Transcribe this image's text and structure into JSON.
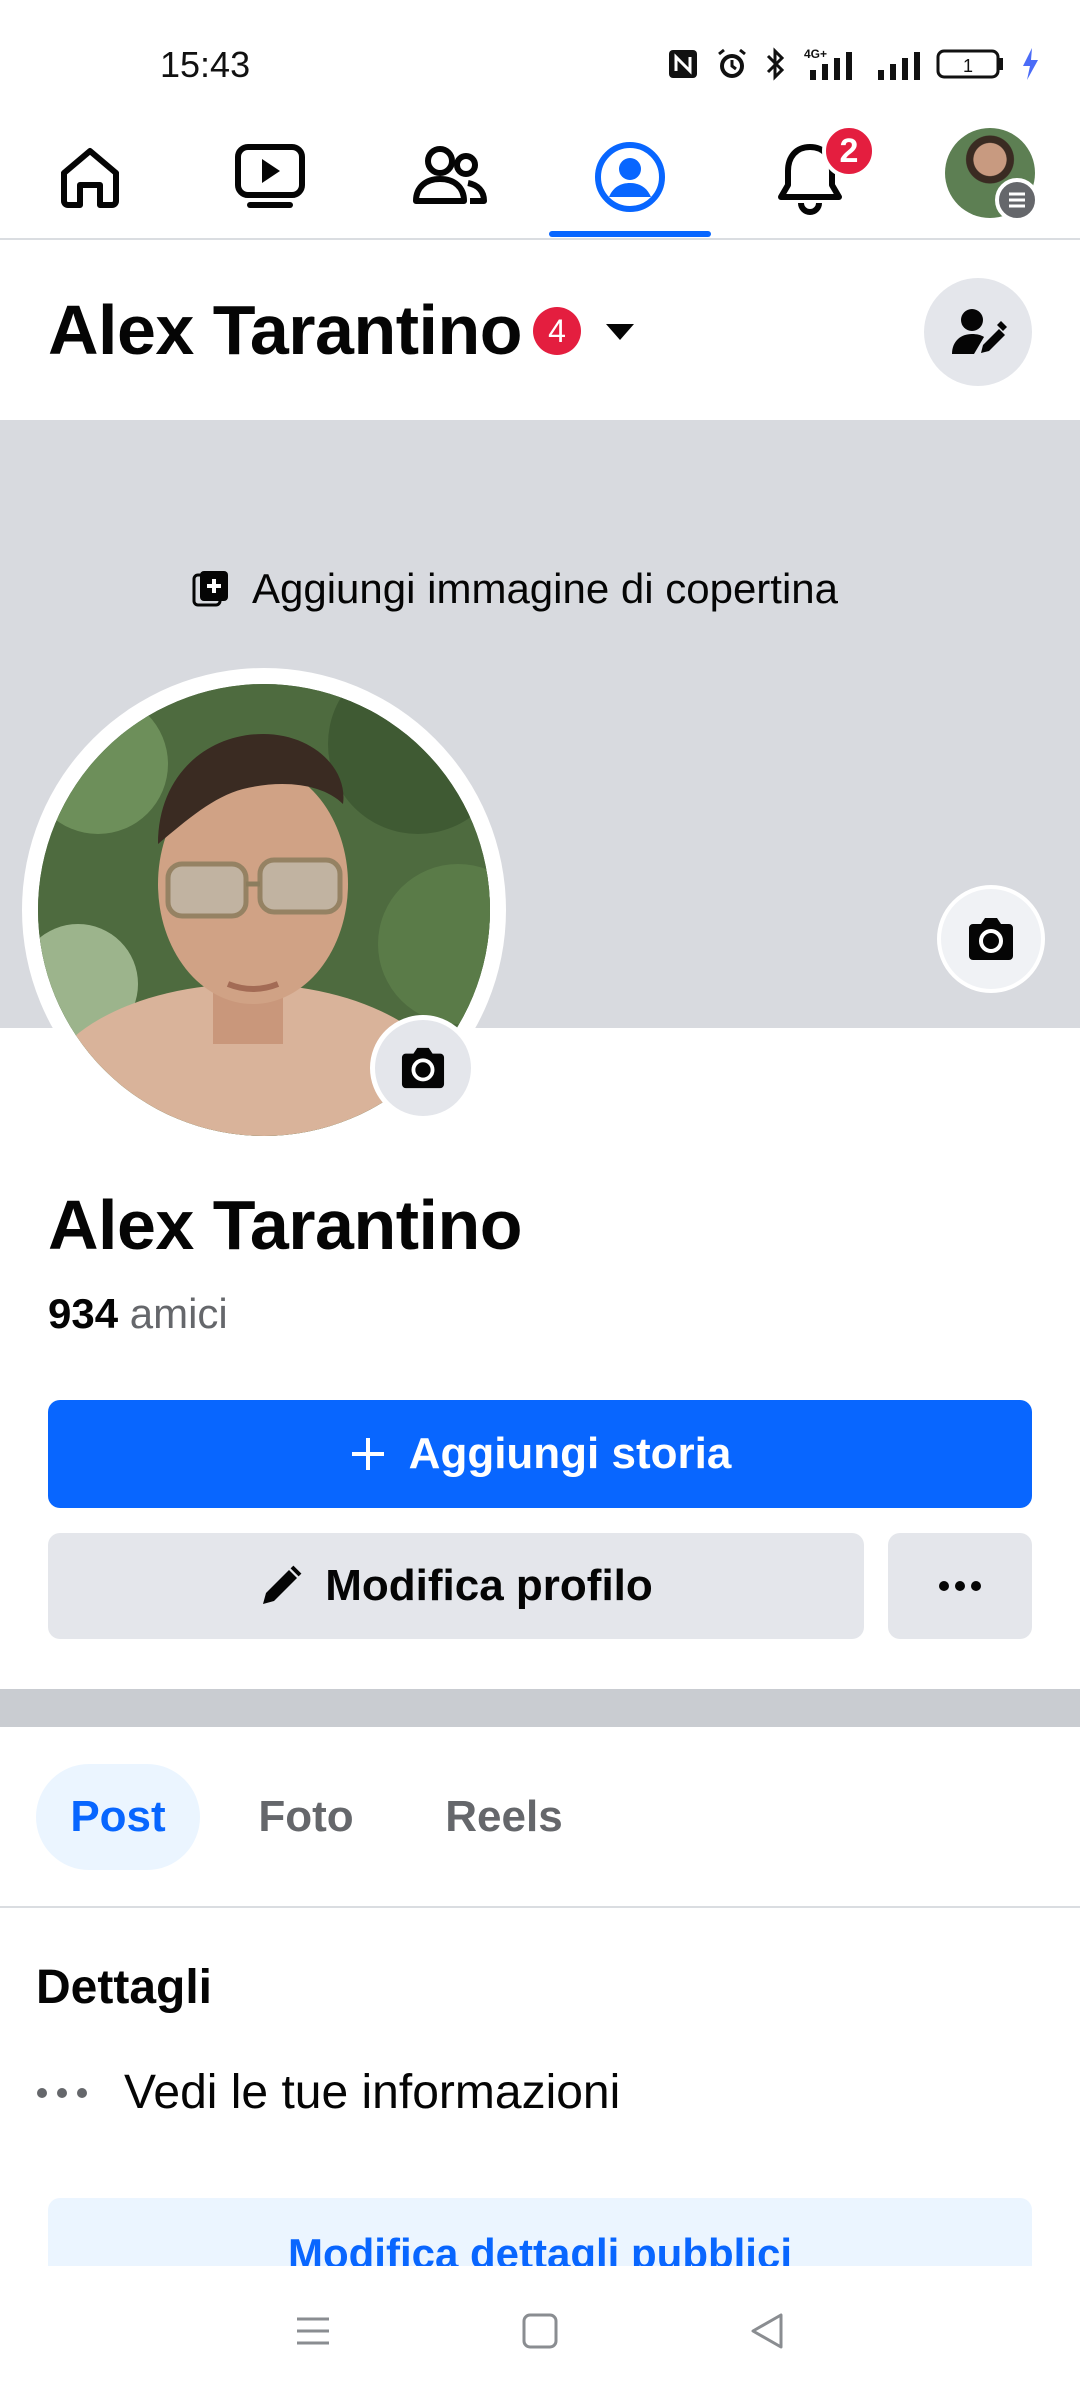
{
  "status_bar": {
    "time": "15:43",
    "battery": "1"
  },
  "nav": {
    "notification_count": "2",
    "tabs": [
      {
        "name": "home",
        "icon": "home-icon"
      },
      {
        "name": "video",
        "icon": "video-icon"
      },
      {
        "name": "friends",
        "icon": "friends-icon"
      },
      {
        "name": "profile",
        "icon": "profile-icon",
        "active": true
      },
      {
        "name": "notifications",
        "icon": "bell-icon"
      },
      {
        "name": "menu",
        "icon": "avatar-menu-icon"
      }
    ]
  },
  "header": {
    "name": "Alex Tarantino",
    "badge": "4"
  },
  "cover": {
    "add_label": "Aggiungi immagine di copertina"
  },
  "profile": {
    "name": "Alex Tarantino",
    "friends_count": "934",
    "friends_label": "amici"
  },
  "actions": {
    "add_story": "Aggiungi storia",
    "edit_profile": "Modifica profilo"
  },
  "tabs": [
    "Post",
    "Foto",
    "Reels"
  ],
  "details": {
    "title": "Dettagli",
    "see_info": "Vedi le tue informazioni",
    "edit_public": "Modifica dettagli pubblici"
  },
  "colors": {
    "accent": "#0866ff",
    "badge": "#e41e3f",
    "cover": "#d8dadf"
  }
}
